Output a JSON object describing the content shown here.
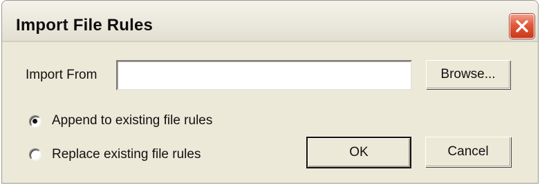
{
  "window": {
    "title": "Import File Rules"
  },
  "import": {
    "label": "Import From",
    "value": "",
    "placeholder": ""
  },
  "buttons": {
    "browse": "Browse...",
    "ok": "OK",
    "cancel": "Cancel"
  },
  "options": {
    "selected": "append",
    "append_label": "Append to existing file rules",
    "replace_label": "Replace existing file rules"
  },
  "icons": {
    "close": "close-icon",
    "radio_selected": "radio-selected-icon",
    "radio_unselected": "radio-unselected-icon"
  },
  "colors": {
    "dialog_background": "#ece9d8",
    "close_button": "#e2593a"
  }
}
